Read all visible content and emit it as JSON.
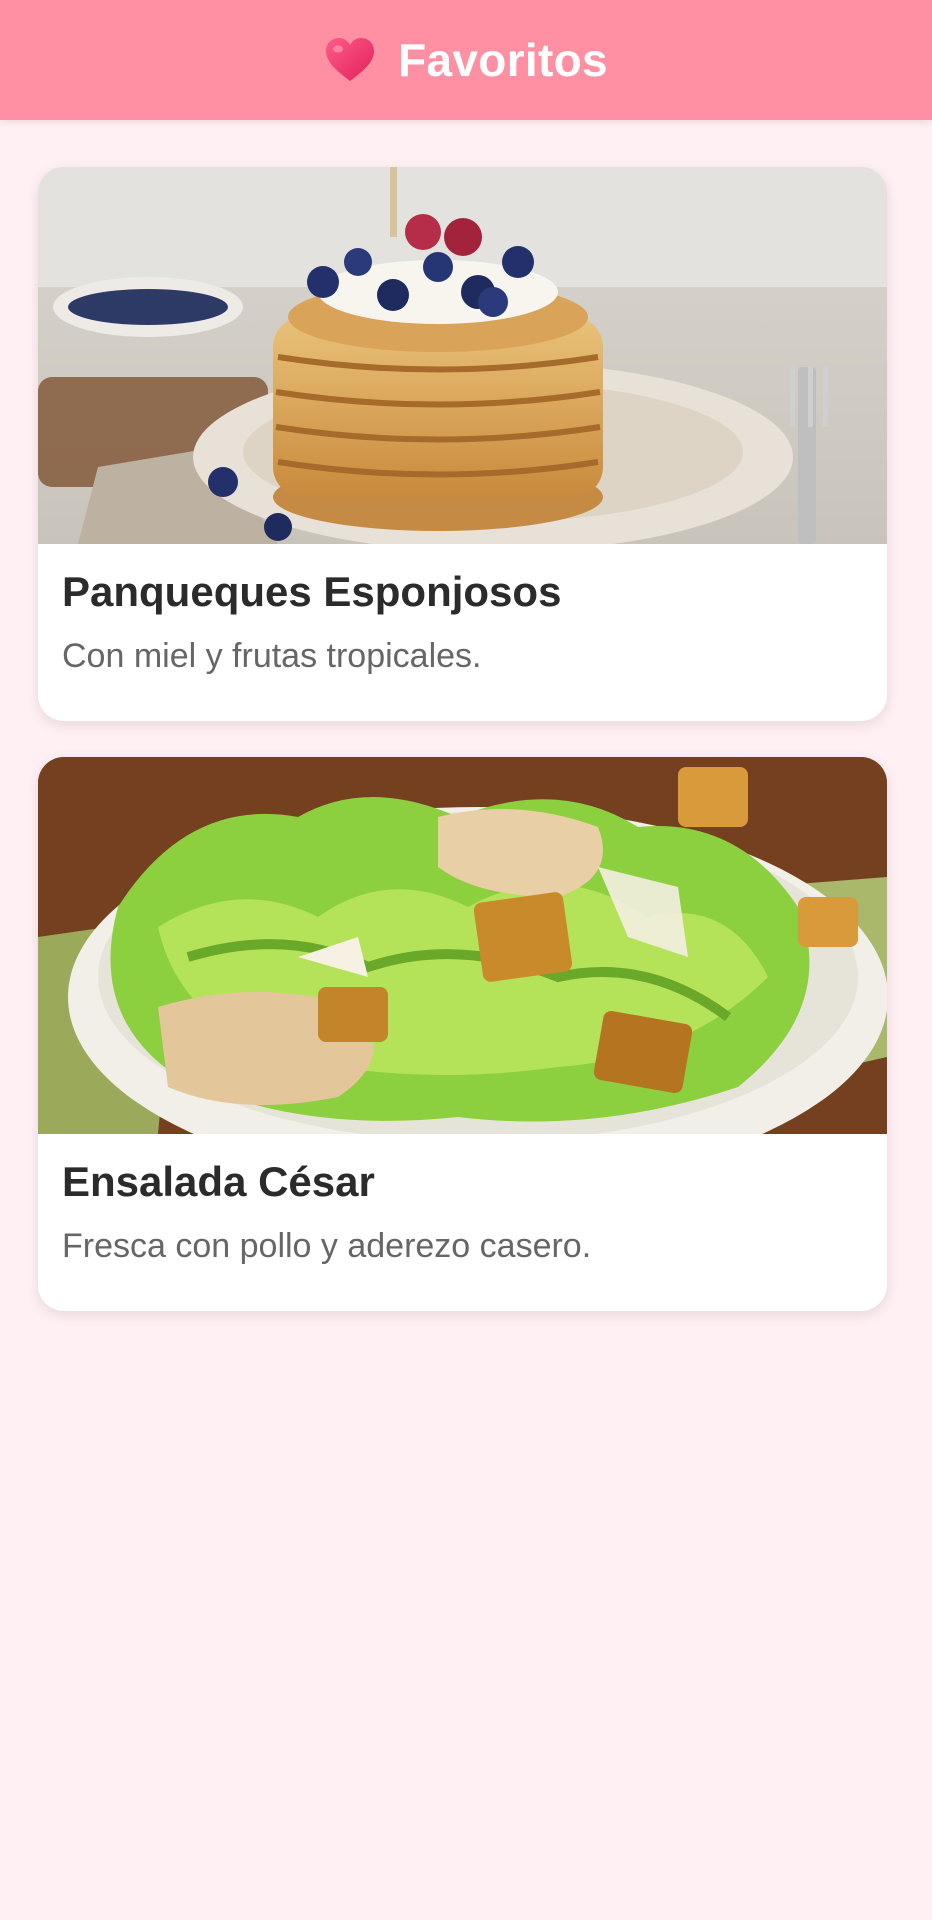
{
  "header": {
    "icon": "heart-icon",
    "title": "Favoritos",
    "background": "#ff8fa3"
  },
  "favorites": [
    {
      "title": "Panqueques Esponjosos",
      "description": "Con miel y frutas tropicales.",
      "image": "pancake-stack-photo"
    },
    {
      "title": "Ensalada César",
      "description": "Fresca con pollo y aderezo casero.",
      "image": "caesar-salad-photo"
    }
  ]
}
